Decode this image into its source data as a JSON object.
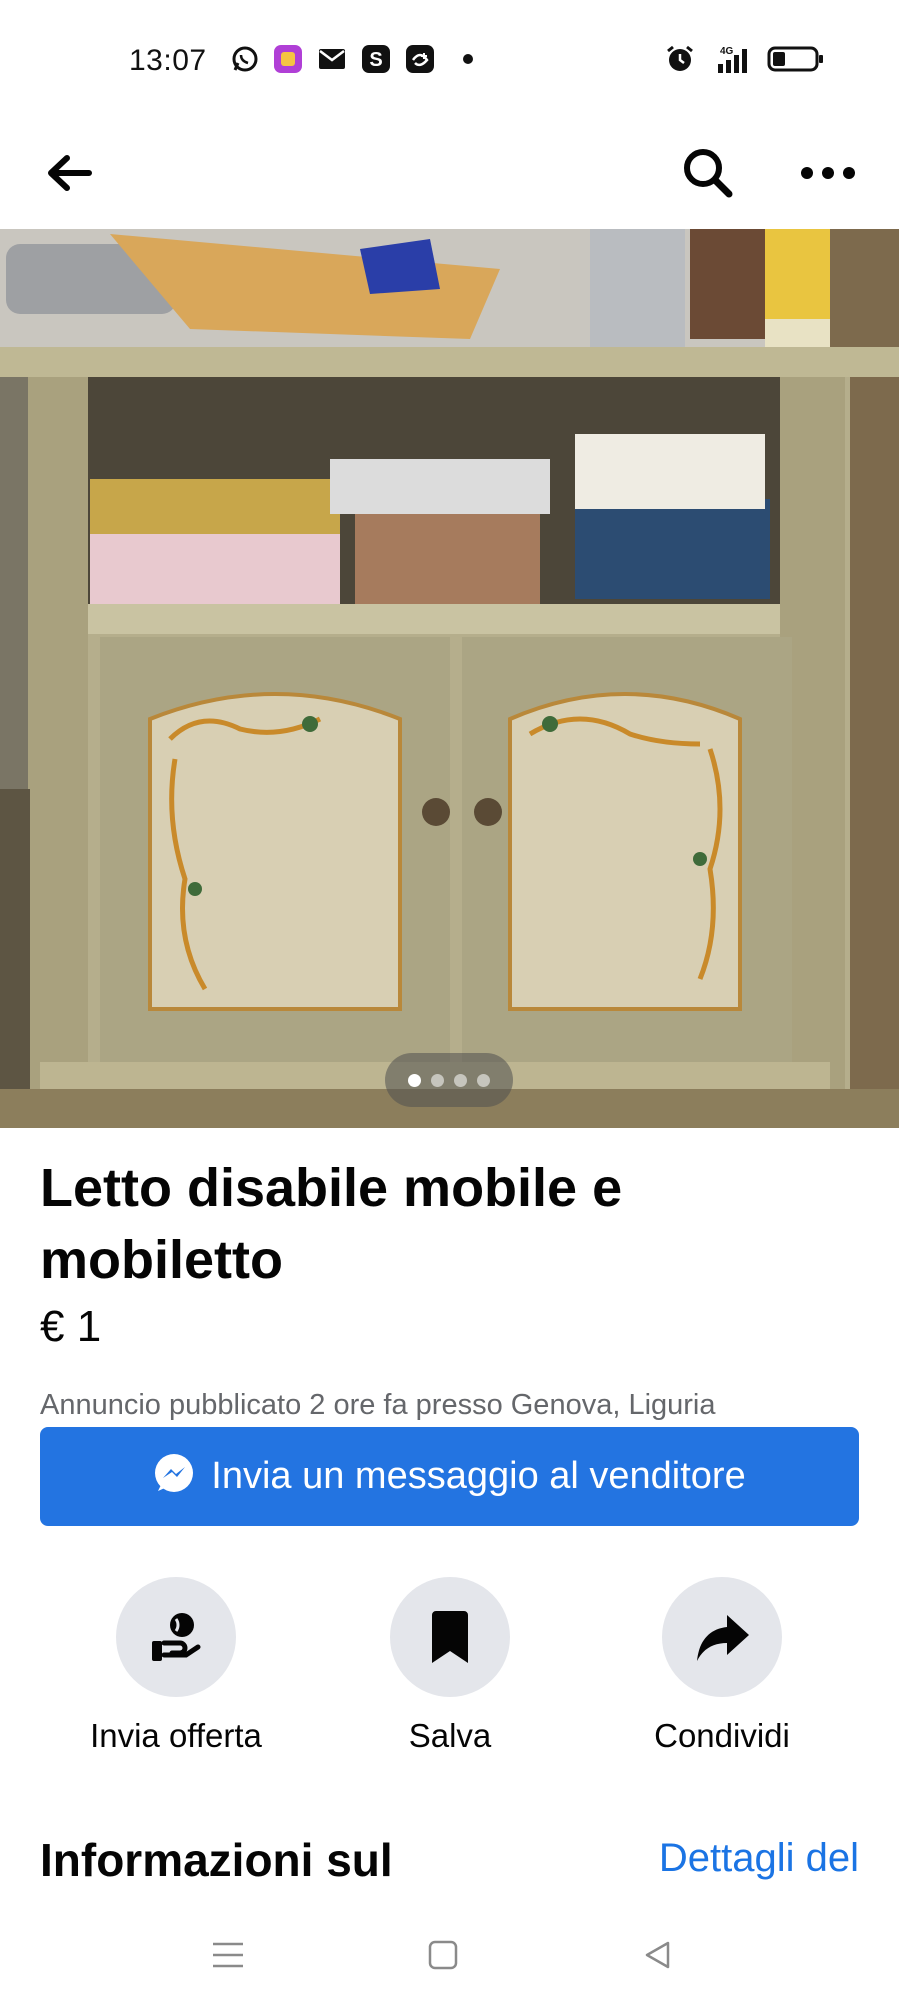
{
  "status_bar": {
    "time": "13:07",
    "icons": [
      "whatsapp-icon",
      "app-icon",
      "mail-icon",
      "s-app-icon",
      "disney-plus-icon",
      "alarm-icon",
      "signal-4g-icon",
      "battery-icon"
    ],
    "network": "4G"
  },
  "top_nav": {
    "icons": [
      "back-arrow-icon",
      "search-icon",
      "more-options-icon"
    ]
  },
  "photo": {
    "pager_count": 4,
    "pager_active": 1
  },
  "listing": {
    "title": "Letto disabile mobile e mobiletto",
    "price": "€ 1",
    "posted": "Annuncio pubblicato 2 ore fa presso Genova, Liguria"
  },
  "message_button": {
    "label": "Invia un messaggio al venditore",
    "icon": "messenger-icon",
    "color": "#2374e1"
  },
  "actions": [
    {
      "label": "Invia offerta",
      "icon": "offer-icon"
    },
    {
      "label": "Salva",
      "icon": "bookmark-icon"
    },
    {
      "label": "Condividi",
      "icon": "share-icon"
    }
  ],
  "section": {
    "title": "Informazioni sul",
    "link": "Dettagli del"
  },
  "system_nav": {
    "icons": [
      "menu-icon",
      "home-icon",
      "back-icon"
    ]
  },
  "colors": {
    "accent": "#2374e1",
    "link": "#1b74e4",
    "secondary_text": "#65676b",
    "action_circle": "#e4e6eb"
  }
}
